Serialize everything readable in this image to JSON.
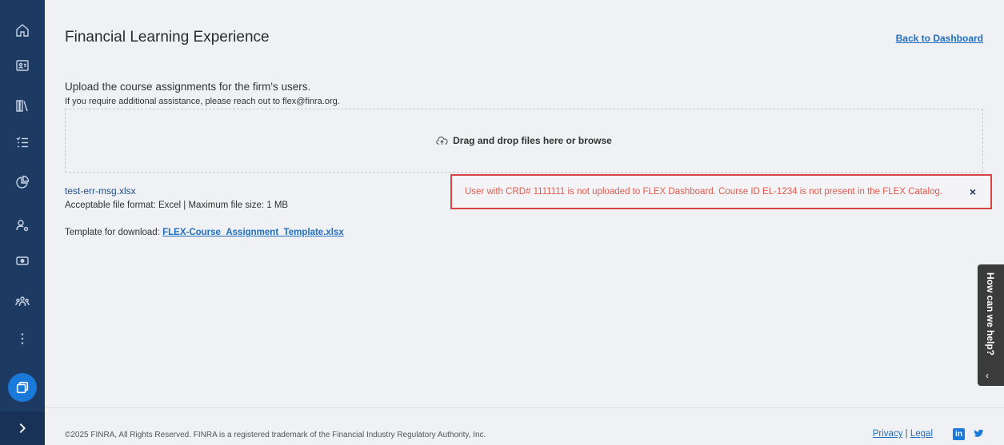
{
  "sidebar": {
    "items": [
      {
        "icon": "home-icon"
      },
      {
        "icon": "id-card-icon"
      },
      {
        "icon": "library-icon"
      },
      {
        "icon": "checklist-icon"
      },
      {
        "icon": "pie-chart-icon"
      },
      {
        "icon": "user-settings-icon"
      },
      {
        "icon": "money-icon"
      },
      {
        "icon": "users-group-icon"
      },
      {
        "icon": "more-vertical-icon"
      }
    ],
    "active_icon": "window-icon",
    "expand_icon": "chevron-right-icon",
    "colors": {
      "background": "#1d3a63",
      "active": "#1a79d9"
    }
  },
  "header": {
    "title": "Financial Learning Experience",
    "back_link": "Back to Dashboard"
  },
  "upload": {
    "intro": "Upload the course assignments for the firm's users.",
    "help_text": "If you require additional assistance, please reach out to flex@finra.org.",
    "dropzone_label": "Drag and drop files here or browse",
    "file_name": "test-err-msg.xlsx",
    "file_format": "Acceptable file format: Excel | Maximum file size: 1 MB",
    "template_prefix": "Template for download:",
    "template_link": "FLEX-Course_Assignment_Template.xlsx"
  },
  "error": {
    "message": "User with CRD# 1111111 is not uploaded to FLEX Dashboard. Course ID EL-1234 is not present in the FLEX Catalog.",
    "close": "×",
    "color": "#e05a4f"
  },
  "help_tab": {
    "label": "How can we help?",
    "chevron": "‹"
  },
  "footer": {
    "copyright": "©2025 FINRA, All Rights Reserved. FINRA is a registered trademark of the Financial Industry Regulatory Authority, Inc.",
    "privacy": "Privacy",
    "separator": "|",
    "legal": "Legal",
    "linkedin": "in"
  }
}
